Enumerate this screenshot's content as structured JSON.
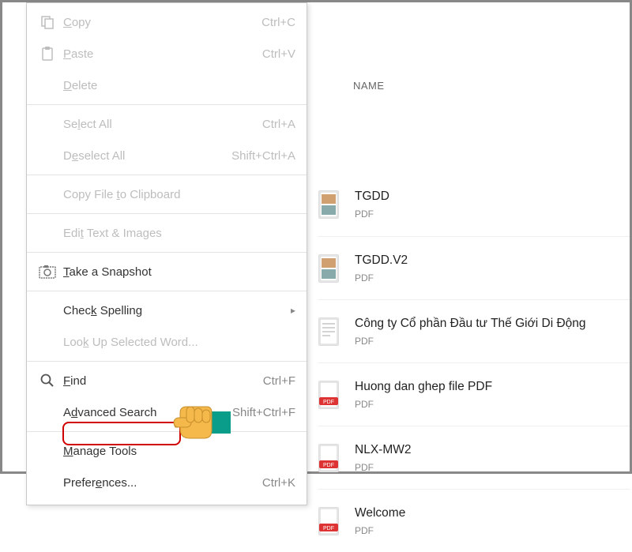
{
  "menu": {
    "items": [
      {
        "id": "copy",
        "label": "Copy",
        "shortcut": "Ctrl+C",
        "disabled": true,
        "icon": "copy-icon",
        "accel_index": 0
      },
      {
        "id": "paste",
        "label": "Paste",
        "shortcut": "Ctrl+V",
        "disabled": true,
        "icon": "paste-icon",
        "accel_index": 0
      },
      {
        "id": "delete",
        "label": "Delete",
        "shortcut": "",
        "disabled": true,
        "icon": "",
        "accel_index": 0
      },
      {
        "sep": true
      },
      {
        "id": "select-all",
        "label": "Select All",
        "shortcut": "Ctrl+A",
        "disabled": true,
        "icon": "",
        "accel_index": 2
      },
      {
        "id": "deselect-all",
        "label": "Deselect All",
        "shortcut": "Shift+Ctrl+A",
        "disabled": true,
        "icon": "",
        "accel_index": 1
      },
      {
        "sep": true
      },
      {
        "id": "copy-file-clipboard",
        "label": "Copy File to Clipboard",
        "shortcut": "",
        "disabled": true,
        "icon": "",
        "accel_index": 10
      },
      {
        "sep": true
      },
      {
        "id": "edit-text-images",
        "label": "Edit Text & Images",
        "shortcut": "",
        "disabled": true,
        "icon": "",
        "accel_index": 3
      },
      {
        "sep": true
      },
      {
        "id": "take-snapshot",
        "label": "Take a Snapshot",
        "shortcut": "",
        "disabled": false,
        "icon": "camera-icon",
        "accel_index": 0
      },
      {
        "sep": true
      },
      {
        "id": "check-spelling",
        "label": "Check Spelling",
        "shortcut": "",
        "disabled": false,
        "submenu": true,
        "icon": "",
        "accel_index": 4
      },
      {
        "id": "lookup-word",
        "label": "Look Up Selected Word...",
        "shortcut": "",
        "disabled": true,
        "icon": "",
        "accel_index": 3
      },
      {
        "sep": true
      },
      {
        "id": "find",
        "label": "Find",
        "shortcut": "Ctrl+F",
        "disabled": false,
        "icon": "search-icon",
        "accel_index": 0
      },
      {
        "id": "advanced-search",
        "label": "Advanced Search",
        "shortcut": "Shift+Ctrl+F",
        "disabled": false,
        "icon": "",
        "accel_index": 1
      },
      {
        "sep": true
      },
      {
        "id": "manage-tools",
        "label": "Manage Tools",
        "shortcut": "",
        "disabled": false,
        "icon": "",
        "accel_index": 0
      },
      {
        "id": "preferences",
        "label": "Preferences...",
        "shortcut": "Ctrl+K",
        "disabled": false,
        "icon": "",
        "accel_index": 6
      }
    ]
  },
  "files": {
    "header": "NAME",
    "rows": [
      {
        "title": "TGDD",
        "type": "PDF",
        "thumb": "picture"
      },
      {
        "title": "TGDD.V2",
        "type": "PDF",
        "thumb": "picture"
      },
      {
        "title": "Công ty Cổ phần Đầu tư Thế Giới Di Động",
        "type": "PDF",
        "thumb": "doc"
      },
      {
        "title": "Huong dan ghep file PDF",
        "type": "PDF",
        "thumb": "pdf"
      },
      {
        "title": "NLX-MW2",
        "type": "PDF",
        "thumb": "pdf"
      },
      {
        "title": "Welcome",
        "type": "PDF",
        "thumb": "pdf"
      }
    ]
  }
}
